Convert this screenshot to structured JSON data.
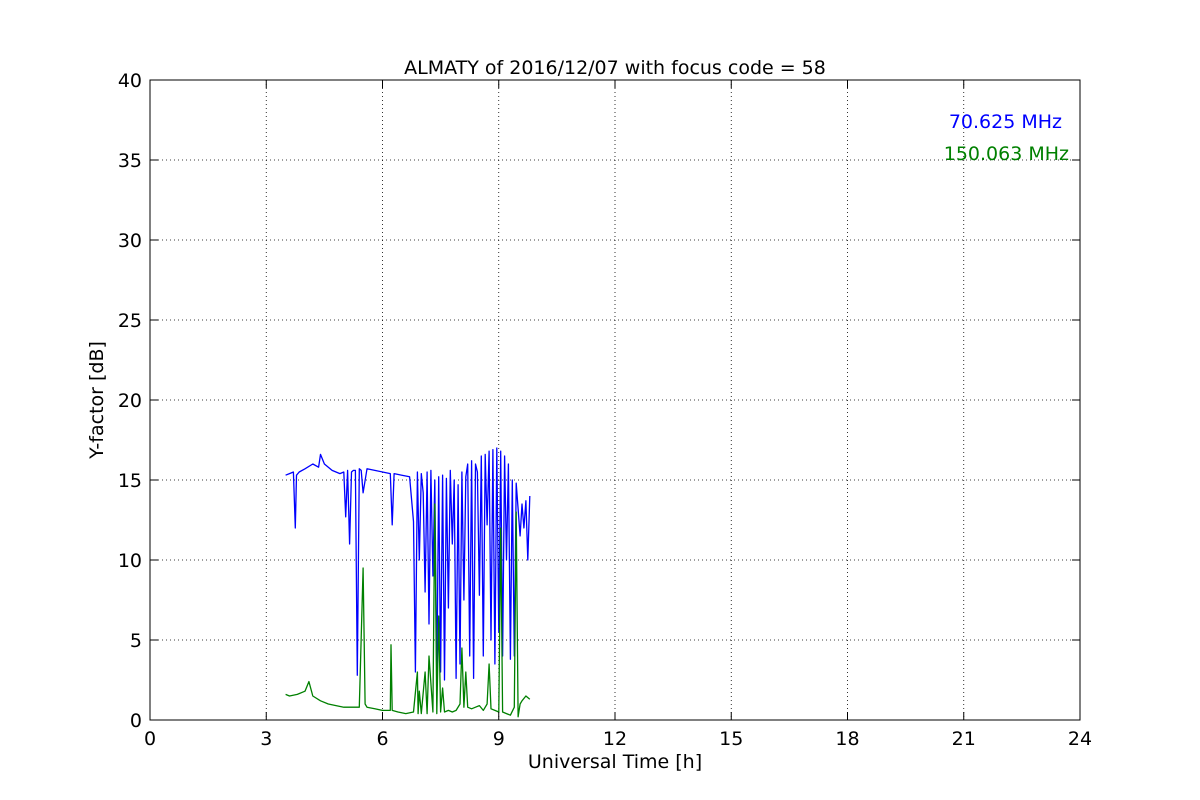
{
  "chart_data": {
    "type": "line",
    "title": "ALMATY of 2016/12/07 with focus code = 58",
    "xlabel": "Universal Time [h]",
    "ylabel": "Y-factor [dB]",
    "xlim": [
      0,
      24
    ],
    "ylim": [
      0,
      40
    ],
    "xticks": [
      0,
      3,
      6,
      9,
      12,
      15,
      18,
      21,
      24
    ],
    "yticks": [
      0,
      5,
      10,
      15,
      20,
      25,
      30,
      35,
      40
    ],
    "grid": true,
    "legend_position": "top-right",
    "series": [
      {
        "name": "70.625 MHz",
        "color": "#0000ff",
        "x": [
          3.5,
          3.6,
          3.7,
          3.75,
          3.78,
          3.85,
          4.0,
          4.2,
          4.35,
          4.4,
          4.5,
          4.7,
          4.9,
          5.0,
          5.05,
          5.1,
          5.15,
          5.2,
          5.25,
          5.3,
          5.35,
          5.4,
          5.45,
          5.5,
          5.6,
          5.8,
          6.0,
          6.2,
          6.25,
          6.3,
          6.5,
          6.7,
          6.8,
          6.85,
          6.9,
          6.95,
          7.0,
          7.05,
          7.1,
          7.15,
          7.2,
          7.25,
          7.3,
          7.35,
          7.4,
          7.45,
          7.5,
          7.55,
          7.6,
          7.65,
          7.7,
          7.75,
          7.8,
          7.85,
          7.9,
          7.95,
          8.0,
          8.05,
          8.1,
          8.15,
          8.2,
          8.25,
          8.3,
          8.35,
          8.4,
          8.45,
          8.5,
          8.55,
          8.6,
          8.65,
          8.7,
          8.75,
          8.8,
          8.85,
          8.9,
          8.95,
          9.0,
          9.05,
          9.1,
          9.15,
          9.2,
          9.25,
          9.3,
          9.35,
          9.4,
          9.45,
          9.5,
          9.55,
          9.6,
          9.65,
          9.7,
          9.75,
          9.8
        ],
        "y": [
          15.3,
          15.4,
          15.5,
          12.0,
          15.3,
          15.5,
          15.7,
          16.0,
          15.8,
          16.6,
          16.0,
          15.6,
          15.4,
          15.5,
          12.7,
          15.6,
          11.0,
          15.5,
          15.6,
          15.6,
          2.8,
          15.7,
          15.6,
          14.2,
          15.7,
          15.6,
          15.5,
          15.4,
          12.2,
          15.4,
          15.3,
          15.2,
          12.4,
          3.0,
          15.5,
          10.0,
          15.4,
          14.2,
          8.0,
          15.5,
          6.0,
          15.6,
          9.0,
          15.0,
          2.5,
          15.2,
          3.0,
          15.3,
          2.5,
          15.1,
          7.0,
          15.6,
          11.0,
          15.0,
          2.6,
          14.7,
          3.5,
          15.5,
          7.5,
          15.2,
          16.0,
          4.0,
          16.2,
          2.6,
          16.0,
          15.5,
          7.8,
          16.5,
          4.0,
          16.6,
          12.2,
          16.8,
          5.0,
          16.9,
          3.5,
          17.0,
          5.5,
          16.8,
          4.0,
          16.5,
          10.0,
          16.0,
          3.8,
          15.0,
          4.0,
          14.8,
          13.2,
          11.5,
          13.5,
          12.0,
          13.7,
          10.0,
          14.0
        ]
      },
      {
        "name": "150.063 MHz",
        "color": "#008000",
        "x": [
          3.5,
          3.6,
          3.8,
          4.0,
          4.1,
          4.2,
          4.4,
          4.6,
          4.8,
          5.0,
          5.2,
          5.4,
          5.5,
          5.55,
          5.6,
          5.8,
          6.0,
          6.2,
          6.22,
          6.25,
          6.4,
          6.6,
          6.8,
          6.9,
          6.92,
          6.95,
          7.0,
          7.1,
          7.15,
          7.2,
          7.3,
          7.35,
          7.4,
          7.45,
          7.5,
          7.55,
          7.6,
          7.7,
          7.8,
          7.9,
          8.0,
          8.05,
          8.1,
          8.15,
          8.2,
          8.3,
          8.4,
          8.5,
          8.6,
          8.7,
          8.75,
          8.8,
          8.9,
          9.0,
          9.05,
          9.1,
          9.2,
          9.3,
          9.4,
          9.45,
          9.5,
          9.55,
          9.6,
          9.7,
          9.8
        ],
        "y": [
          1.6,
          1.5,
          1.6,
          1.8,
          2.4,
          1.5,
          1.2,
          1.0,
          0.9,
          0.8,
          0.8,
          0.8,
          9.5,
          1.0,
          0.8,
          0.7,
          0.6,
          0.6,
          4.7,
          0.6,
          0.5,
          0.4,
          0.5,
          3.0,
          0.4,
          1.8,
          0.4,
          3.0,
          0.4,
          4.0,
          0.5,
          13.5,
          0.4,
          6.5,
          0.5,
          2.0,
          0.5,
          0.6,
          0.5,
          0.6,
          1.0,
          4.5,
          0.8,
          3.0,
          0.8,
          0.7,
          0.8,
          0.9,
          0.6,
          1.0,
          3.5,
          0.7,
          0.6,
          0.5,
          12.0,
          0.5,
          0.4,
          0.3,
          0.8,
          13.0,
          0.2,
          1.0,
          1.2,
          1.5,
          1.3
        ]
      }
    ]
  }
}
